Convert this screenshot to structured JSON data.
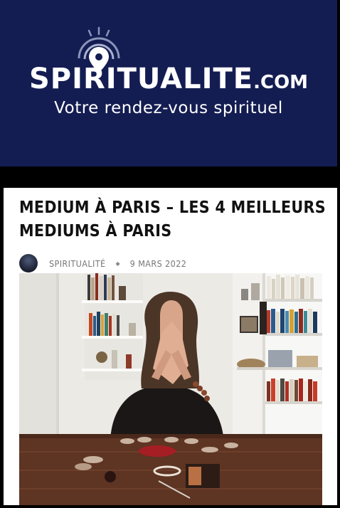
{
  "header": {
    "logo_main": "SPIRITUALITE",
    "logo_domain": ".COM",
    "tagline": "Votre rendez-vous spirituel",
    "background_color": "#141d52"
  },
  "article": {
    "title": "MEDIUM À PARIS – LES 4 MEILLEURS MEDIUMS À PARIS",
    "author": "SPIRITUALITÉ",
    "separator_icon": "diamond-icon",
    "date": "9 MARS 2022"
  }
}
